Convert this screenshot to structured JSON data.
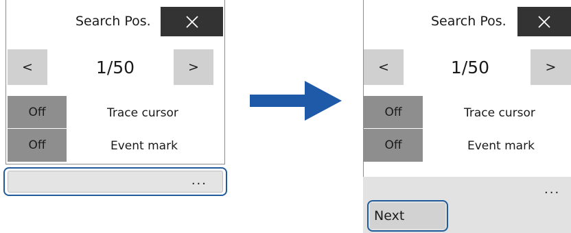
{
  "before": {
    "title": "Search Pos.",
    "prev_label": "<",
    "next_label": ">",
    "counter": "1/50",
    "toggles": [
      {
        "state": "Off",
        "label": "Trace cursor"
      },
      {
        "state": "Off",
        "label": "Event mark"
      }
    ],
    "more_label": "..."
  },
  "after": {
    "title": "Search Pos.",
    "prev_label": "<",
    "next_label": ">",
    "counter": "1/50",
    "toggles": [
      {
        "state": "Off",
        "label": "Trace cursor"
      },
      {
        "state": "Off",
        "label": "Event mark"
      }
    ],
    "more_label": "...",
    "menu_items": [
      "Next"
    ]
  },
  "colors": {
    "highlight": "#1f5b9a",
    "arrow": "#1f5aa8",
    "close_bg": "#333333",
    "toggle_bg": "#8e8e8e",
    "nav_bg": "#d0d0d0"
  },
  "icons": {
    "close": "close-icon",
    "arrow": "right-arrow-icon"
  }
}
